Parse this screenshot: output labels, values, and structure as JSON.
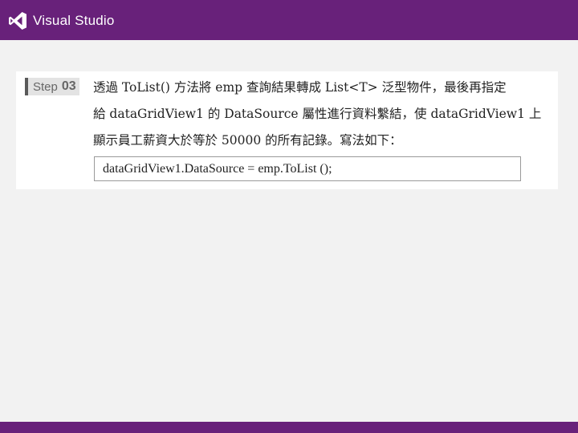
{
  "header": {
    "brand": "Visual Studio",
    "logo_icon": "visual-studio-logo-icon",
    "color": "#68217a"
  },
  "step": {
    "word": "Step",
    "number": "03"
  },
  "instruction": {
    "lines": [
      "透過 ToList() 方法將 emp 查詢結果轉成 List<T> 泛型物件，最後再指定",
      "給 dataGridView1 的 DataSource 屬性進行資料繫結，使 dataGridView1 上",
      "顯示員工薪資大於等於 50000 的所有記錄。寫法如下："
    ]
  },
  "code": "dataGridView1.DataSource = emp.ToList ();"
}
